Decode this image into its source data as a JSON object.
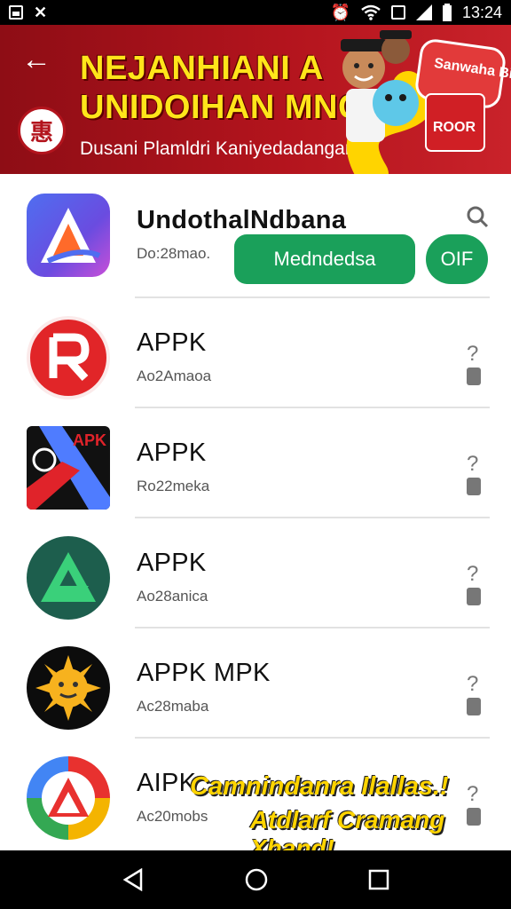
{
  "status_bar": {
    "time": "13:24"
  },
  "banner": {
    "title_line1": "NEJANHIANI A",
    "title_line2": "UNIDOIHAN MNCINA",
    "subtitle": "Dusani Plamldri Kaniyedadangan",
    "sticker_text": "Sanwaha Binani",
    "sticker_badge": "ROOR"
  },
  "apps": [
    {
      "name": "UndothalNdbana",
      "meta": "Do:28mao.",
      "buttons": [
        "Medndedsa",
        "OIF"
      ]
    },
    {
      "name": "APPK",
      "meta": "Ao2Amaoa"
    },
    {
      "name": "APPK",
      "meta": "Ro22meka",
      "icon_text": "APK"
    },
    {
      "name": "APPK",
      "meta": "Ao28anica"
    },
    {
      "name": "APPK MPK",
      "meta": "Ac28maba"
    },
    {
      "name": "AIPK",
      "meta": "Ac20mobs"
    }
  ],
  "overlay": {
    "line1": "Camnindanra Ilallas.!",
    "line2": "Atdlarf Cramang Xhand!"
  },
  "colors": {
    "banner_red": "#b3141d",
    "title_yellow": "#ffe51a",
    "button_green": "#1aa05a"
  }
}
